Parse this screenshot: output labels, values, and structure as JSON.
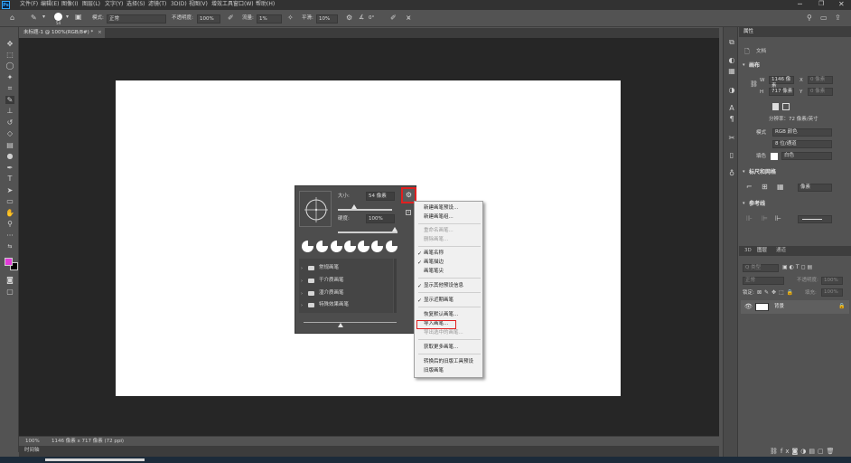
{
  "app": {
    "logo": "Ps"
  },
  "menubar": {
    "items": [
      "文件(F)",
      "编辑(E)",
      "图像(I)",
      "图层(L)",
      "文字(Y)",
      "选择(S)",
      "滤镜(T)",
      "3D(D)",
      "视图(V)",
      "增效工具",
      "窗口(W)",
      "帮助(H)"
    ]
  },
  "options": {
    "brush_size": "54",
    "mode_label": "模式:",
    "mode_value": "正常",
    "opacity_label": "不透明度:",
    "opacity_value": "100%",
    "flow_label": "流量:",
    "flow_value": "1%",
    "smooth_label": "平滑:",
    "smooth_value": "10%",
    "angle_value": "0°"
  },
  "document": {
    "tab_title": "未标题-1 @ 100%(RGB/8#) *"
  },
  "brush_panel": {
    "size_label": "大小:",
    "size_value": "54 像素",
    "hardness_label": "硬度:",
    "hardness_value": "100%",
    "folders": [
      "常规画笔",
      "干介质画笔",
      "湿介质画笔",
      "特殊效果画笔"
    ]
  },
  "context_menu": {
    "items": [
      {
        "label": "新建画笔预设...",
        "enabled": true,
        "checked": false
      },
      {
        "label": "新建画笔组...",
        "enabled": true,
        "checked": false
      },
      {
        "label": "重命名画笔...",
        "enabled": false,
        "checked": false
      },
      {
        "label": "删除画笔...",
        "enabled": false,
        "checked": false
      },
      {
        "label": "画笔名称",
        "enabled": true,
        "checked": true
      },
      {
        "label": "画笔描边",
        "enabled": true,
        "checked": true
      },
      {
        "label": "画笔笔尖",
        "enabled": true,
        "checked": false
      },
      {
        "label": "显示其他预设信息",
        "enabled": true,
        "checked": true
      },
      {
        "label": "显示近期画笔",
        "enabled": true,
        "checked": true
      },
      {
        "label": "恢复默认画笔...",
        "enabled": true,
        "checked": false
      },
      {
        "label": "导入画笔...",
        "enabled": true,
        "checked": false
      },
      {
        "label": "导出选中的画笔...",
        "enabled": false,
        "checked": false
      },
      {
        "label": "获取更多画笔...",
        "enabled": true,
        "checked": false
      },
      {
        "label": "转换后的旧版工具预设",
        "enabled": true,
        "checked": false
      },
      {
        "label": "旧版画笔",
        "enabled": true,
        "checked": false
      }
    ]
  },
  "status": {
    "zoom": "100%",
    "doc_info": "1146 像素 x 717 像素 (72 ppi)",
    "timeline_tab": "时间轴"
  },
  "properties": {
    "tab": "属性",
    "doc_label": "文档",
    "canvas_head": "画布",
    "w_label": "W",
    "w_value": "1146 像素",
    "h_label": "H",
    "h_value": "717 像素",
    "x_label": "X",
    "x_placeholder": "0 像素",
    "y_label": "Y",
    "y_placeholder": "0 像素",
    "resolution": "分辨率：72 像素/英寸",
    "mode_label": "模式",
    "mode_value": "RGB 颜色",
    "bits_value": "8 位/通道",
    "fill_label": "填色",
    "fill_value": "白色",
    "rulers_head": "标尺和网格",
    "ruler_unit": "像素",
    "guides_head": "参考线"
  },
  "layers": {
    "tabs": [
      "3D",
      "图层",
      "通道"
    ],
    "kind_placeholder": "Q 类型",
    "blend_value": "正常",
    "opacity_label": "不透明度:",
    "opacity_value": "100%",
    "lock_label": "锁定:",
    "fill_label": "填充:",
    "fill_value": "100%",
    "layer_name": "背景"
  },
  "colors": {
    "foreground": "#e13ad8",
    "background": "#000000",
    "highlight": "#e02020"
  }
}
